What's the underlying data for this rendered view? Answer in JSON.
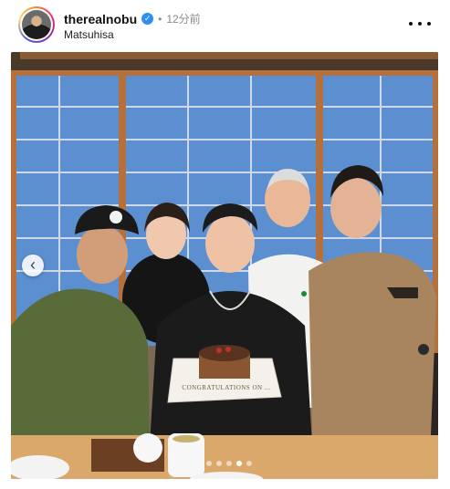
{
  "post": {
    "username": "thereal​nobu",
    "verified": true,
    "separator": "•",
    "time_ago": "12分前",
    "location": "Matsuhisa"
  },
  "media": {
    "cake_text": "CONGRATULATIONS ON ... ",
    "carousel": {
      "count": 5,
      "active_index": 3
    }
  },
  "icons": {
    "verified": "verified-badge-icon",
    "more": "more-options-icon",
    "prev": "chevron-left-icon"
  },
  "colors": {
    "verified_blue": "#2f8ff0",
    "window_blue": "#5b8fd0",
    "frame_wood": "#b5703b"
  }
}
